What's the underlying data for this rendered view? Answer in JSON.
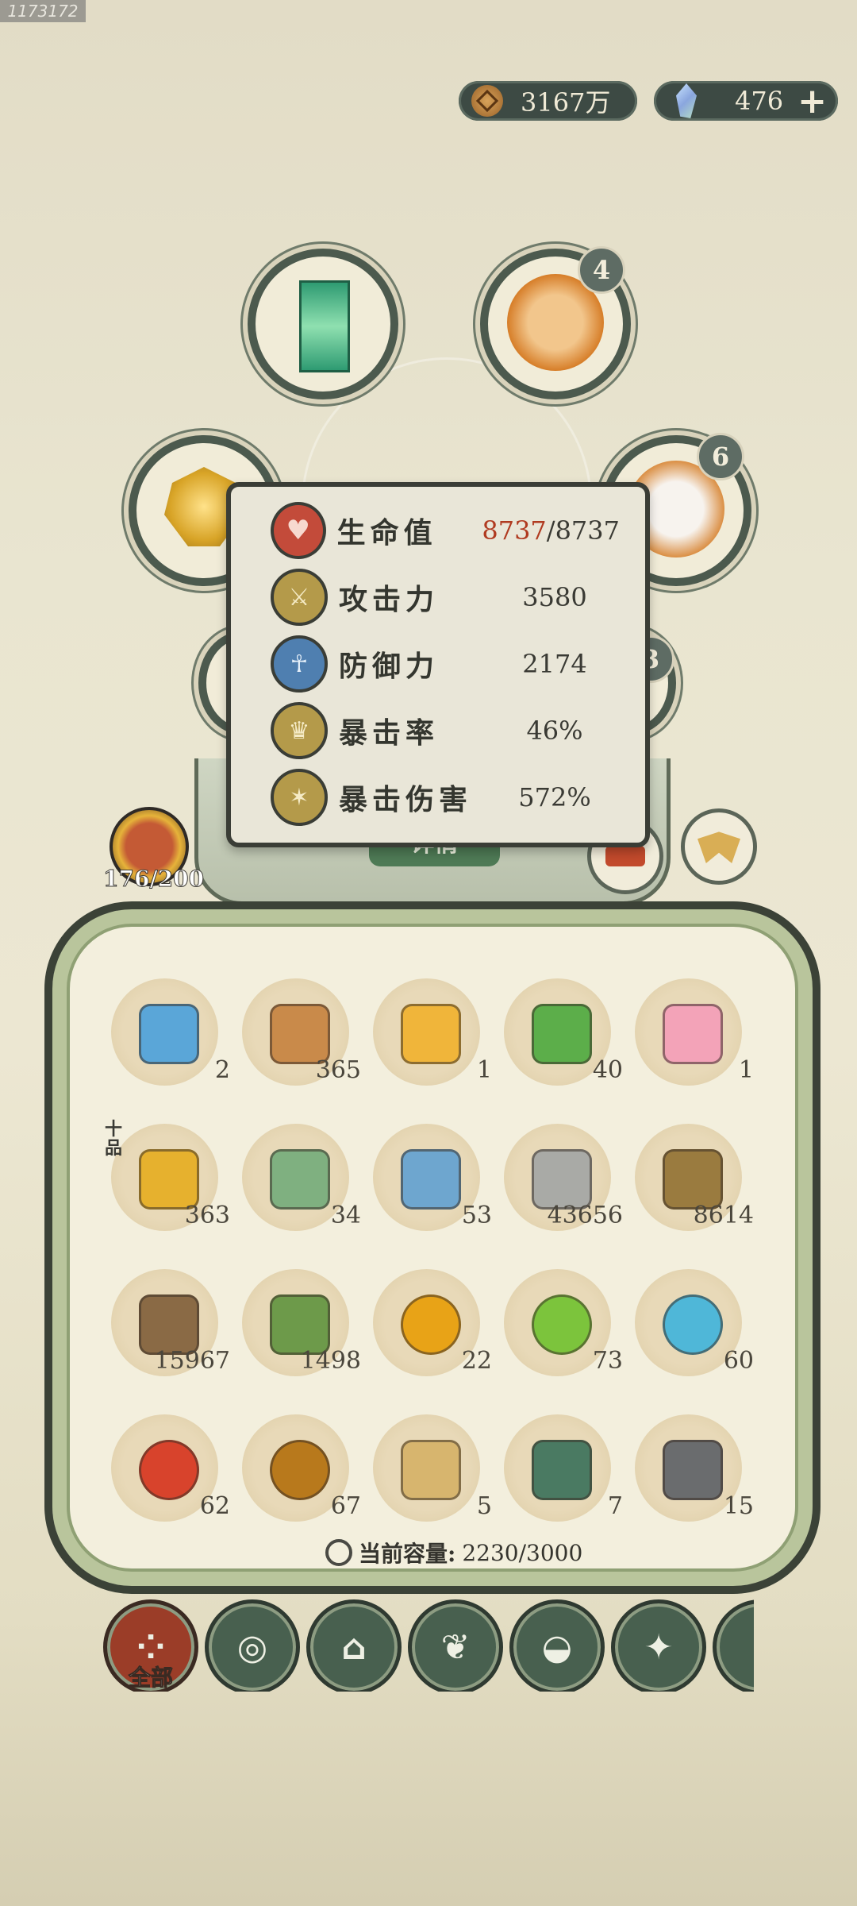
{
  "id_tag": "1173172",
  "currency": {
    "coins": "3167万",
    "gems": "476",
    "plus": "+"
  },
  "badges": {
    "top_right": "4",
    "mid_right": "6",
    "partial": "3"
  },
  "stats": [
    {
      "name": "生命值",
      "current": "8737",
      "max": "/8737",
      "icon": "heart-icon",
      "color": "#c34b3a"
    },
    {
      "name": "攻击力",
      "value": "3580",
      "icon": "sword-icon",
      "color": "#b49a4a"
    },
    {
      "name": "防御力",
      "value": "2174",
      "icon": "shield-person-icon",
      "color": "#4f7fb0"
    },
    {
      "name": "暴击率",
      "value": "46%",
      "icon": "crown-flame-icon",
      "color": "#b49a4a"
    },
    {
      "name": "暴击伤害",
      "value": "572%",
      "icon": "burst-icon",
      "color": "#b49a4a"
    }
  ],
  "details_button": "详情",
  "monkey_capacity": "176/200",
  "items": [
    {
      "icon": "scroll-ticket-icon",
      "count": "2"
    },
    {
      "icon": "map-scroll-icon",
      "count": "365"
    },
    {
      "icon": "talisman-icon",
      "count": "1"
    },
    {
      "icon": "potion-icon",
      "count": "40"
    },
    {
      "icon": "lotus-icon",
      "count": "1"
    },
    {
      "icon": "golden-fruit-icon",
      "count": "363",
      "grade": "十品"
    },
    {
      "icon": "green-pouch-icon",
      "count": "34"
    },
    {
      "icon": "blue-pouch-icon",
      "count": "53"
    },
    {
      "icon": "stone-icon",
      "count": "43656"
    },
    {
      "icon": "straw-icon",
      "count": "8614"
    },
    {
      "icon": "log-icon",
      "count": "15967"
    },
    {
      "icon": "bamboo-icon",
      "count": "1498"
    },
    {
      "icon": "gold-orb-icon",
      "count": "22"
    },
    {
      "icon": "green-orb-icon",
      "count": "73"
    },
    {
      "icon": "blue-orb-icon",
      "count": "60"
    },
    {
      "icon": "fire-orb-icon",
      "count": "62"
    },
    {
      "icon": "earth-orb-icon",
      "count": "67"
    },
    {
      "icon": "plank-icon",
      "count": "5"
    },
    {
      "icon": "jade-ingot-icon",
      "count": "7"
    },
    {
      "icon": "iron-ingot-icon",
      "count": "15"
    }
  ],
  "capacity": {
    "label": "当前容量:",
    "value": "2230/3000"
  },
  "tabs": [
    {
      "label": "全部",
      "icon": "grid-icon"
    },
    {
      "icon": "log-icon"
    },
    {
      "icon": "hut-icon"
    },
    {
      "icon": "sprout-icon"
    },
    {
      "icon": "bowl-icon"
    },
    {
      "icon": "map-icon"
    },
    {
      "icon": "scroll-icon"
    }
  ]
}
